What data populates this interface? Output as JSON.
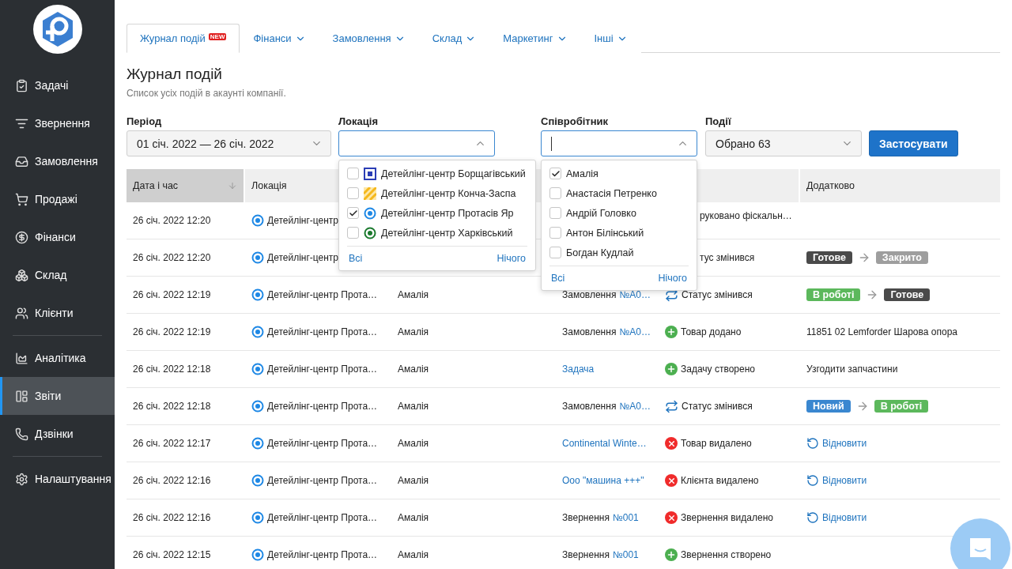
{
  "sidebar": {
    "items": [
      {
        "label": "Задачі",
        "selected": false
      },
      {
        "label": "Звернення",
        "selected": false
      },
      {
        "label": "Замовлення",
        "selected": false
      },
      {
        "label": "Продажі",
        "selected": false
      },
      {
        "label": "Фінанси",
        "selected": false
      },
      {
        "label": "Склад",
        "selected": false
      },
      {
        "label": "Клієнти",
        "selected": false,
        "divider_after": true
      },
      {
        "label": "Аналітика",
        "selected": false
      },
      {
        "label": "Звіти",
        "selected": true
      },
      {
        "label": "Дзвінки",
        "selected": false,
        "divider_after": true
      },
      {
        "label": "Налаштування",
        "selected": false
      }
    ]
  },
  "tabs": [
    {
      "label": "Журнал подій",
      "selected": true,
      "badge": "NEW"
    },
    {
      "label": "Фінанси",
      "selected": false
    },
    {
      "label": "Замовлення",
      "selected": false
    },
    {
      "label": "Склад",
      "selected": false
    },
    {
      "label": "Маркетинг",
      "selected": false
    },
    {
      "label": "Інші",
      "selected": false
    }
  ],
  "page": {
    "title": "Журнал подій",
    "subtitle": "Список усіх подій в акаунті компанії."
  },
  "filters": {
    "period": {
      "label": "Період",
      "value": "01 січ. 2022 — 26 січ. 2022"
    },
    "location": {
      "label": "Локація",
      "expanded": true,
      "options": [
        {
          "label": "Детейлінг-центр Борщагівський",
          "checked": false,
          "kind": "square",
          "color": "#2a3db5"
        },
        {
          "label": "Детейлінг-центр Конча-Заспа",
          "checked": false,
          "kind": "striped",
          "color": "#f5b81c"
        },
        {
          "label": "Детейлінг-центр Протасів Яр",
          "checked": true,
          "kind": "ring",
          "color": "#1e88e5"
        },
        {
          "label": "Детейлінг-центр Харківський",
          "checked": false,
          "kind": "ring",
          "color": "#1b7a2e"
        }
      ],
      "all": "Всі",
      "none": "Нічого"
    },
    "employee": {
      "label": "Співробітник",
      "expanded": true,
      "options": [
        {
          "label": "Амалія",
          "checked": true
        },
        {
          "label": "Анастасія Петренко",
          "checked": false
        },
        {
          "label": "Андрій Головко",
          "checked": false
        },
        {
          "label": "Антон Білінський",
          "checked": false
        },
        {
          "label": "Богдан Кудлай",
          "checked": false
        }
      ],
      "all": "Всі",
      "none": "Нічого"
    },
    "events": {
      "label": "Події",
      "value": "Обрано 63"
    },
    "apply": "Застосувати"
  },
  "table": {
    "columns": [
      {
        "label": "Дата і час",
        "sorted": true
      },
      {
        "label": "Локація"
      },
      {
        "label": "Додатково"
      }
    ],
    "rows": [
      {
        "date": "26 січ. 2022 12:20",
        "location": "Детейлінг-центр",
        "event": {
          "text": "руковано фіскальн…",
          "covered": true
        }
      },
      {
        "date": "26 січ. 2022 12:20",
        "location": "Детейлінг-центр",
        "event": {
          "text": "тус змінився",
          "covered": true
        },
        "extra": {
          "kind": "status",
          "from": {
            "label": "Готове",
            "color": "#4a4a4a"
          },
          "to": {
            "label": "Закрито",
            "color": "#9e9e9e"
          }
        }
      },
      {
        "date": "26 січ. 2022 12:19",
        "location": "Детейлінг-центр Прота…",
        "employee": "Амалія",
        "object": {
          "text": "Замовлення",
          "link": "№А0…"
        },
        "event": {
          "kind": "status",
          "text": "Статус змінився"
        },
        "extra": {
          "kind": "status",
          "from": {
            "label": "В роботі",
            "color": "#5cb85c"
          },
          "to": {
            "label": "Готове",
            "color": "#4a4a4a"
          }
        }
      },
      {
        "date": "26 січ. 2022 12:19",
        "location": "Детейлінг-центр Прота…",
        "employee": "Амалія",
        "object": {
          "text": "Замовлення",
          "link": "№А0…"
        },
        "event": {
          "kind": "added",
          "text": "Товар додано"
        },
        "extra": {
          "kind": "text",
          "text": "11851 02 Lemforder Шарова опора"
        }
      },
      {
        "date": "26 січ. 2022 12:18",
        "location": "Детейлінг-центр Прота…",
        "employee": "Амалія",
        "object": {
          "link": "Задача"
        },
        "event": {
          "kind": "added",
          "text": "Задачу створено"
        },
        "extra": {
          "kind": "text",
          "text": "Узгодити запчастини"
        }
      },
      {
        "date": "26 січ. 2022 12:18",
        "location": "Детейлінг-центр Прота…",
        "employee": "Амалія",
        "object": {
          "text": "Замовлення",
          "link": "№А0…"
        },
        "event": {
          "kind": "status",
          "text": "Статус змінився"
        },
        "extra": {
          "kind": "status",
          "from": {
            "label": "Новий",
            "color": "#3a87d0"
          },
          "to": {
            "label": "В роботі",
            "color": "#5cb85c"
          }
        }
      },
      {
        "date": "26 січ. 2022 12:17",
        "location": "Детейлінг-центр Прота…",
        "employee": "Амалія",
        "object": {
          "link": "Continental Winte…"
        },
        "event": {
          "kind": "removed",
          "text": "Товар видалено"
        },
        "extra": {
          "kind": "restore",
          "text": "Відновити"
        }
      },
      {
        "date": "26 січ. 2022 12:16",
        "location": "Детейлінг-центр Прота…",
        "employee": "Амалія",
        "object": {
          "link": "Ооо \"машина +++\""
        },
        "event": {
          "kind": "removed",
          "text": "Клієнта видалено"
        },
        "extra": {
          "kind": "restore",
          "text": "Відновити"
        }
      },
      {
        "date": "26 січ. 2022 12:16",
        "location": "Детейлінг-центр Прота…",
        "employee": "Амалія",
        "object": {
          "text": "Звернення",
          "link": "№001"
        },
        "event": {
          "kind": "removed",
          "text": "Звернення видалено"
        },
        "extra": {
          "kind": "restore",
          "text": "Відновити"
        }
      },
      {
        "date": "26 січ. 2022 12:15",
        "location": "Детейлінг-центр Прота…",
        "employee": "Амалія",
        "object": {
          "text": "Звернення",
          "link": "№001"
        },
        "event": {
          "kind": "added",
          "text": "Звернення створено"
        }
      }
    ]
  }
}
